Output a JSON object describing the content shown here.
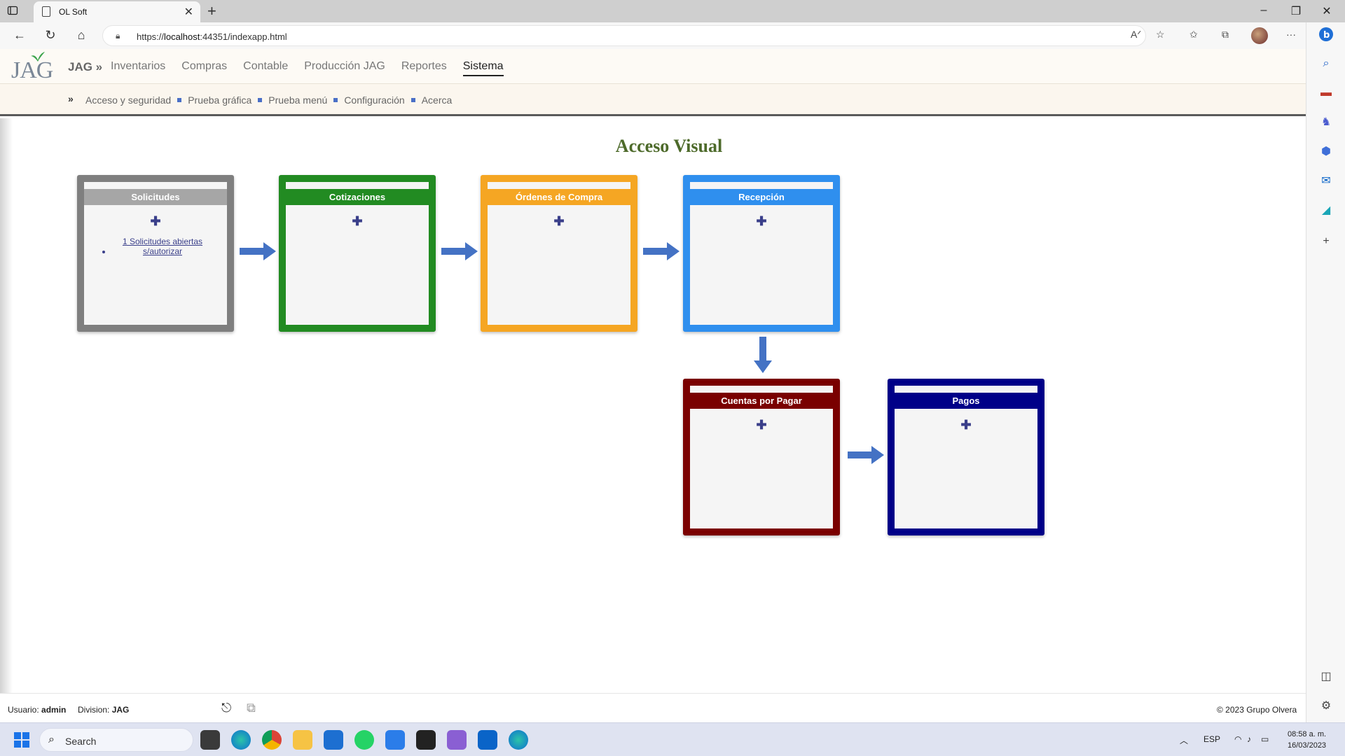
{
  "browser": {
    "tab_title": "OL Soft",
    "url_prefix": "https://",
    "url_host": "localhost",
    "url_rest": ":44351/indexapp.html"
  },
  "app": {
    "logo_text": "JAG",
    "brand": "JAG »",
    "nav": [
      {
        "label": "Inventarios"
      },
      {
        "label": "Compras"
      },
      {
        "label": "Contable"
      },
      {
        "label": "Producción JAG"
      },
      {
        "label": "Reportes"
      },
      {
        "label": "Sistema",
        "active": true
      }
    ],
    "subnav": [
      {
        "label": "Acceso y seguridad"
      },
      {
        "label": "Prueba gráfica"
      },
      {
        "label": "Prueba menú"
      },
      {
        "label": "Configuración"
      },
      {
        "label": "Acerca"
      }
    ],
    "page_title": "Acceso Visual",
    "boxes": [
      {
        "title": "Solicitudes",
        "color": "#7f7f7f",
        "head_color": "#a6a6a6",
        "plus": "✚",
        "items": [
          "1 Solicitudes abiertas s/autorizar"
        ]
      },
      {
        "title": "Cotizaciones",
        "color": "#228b22",
        "head_color": "#228b22",
        "plus": "✚",
        "items": []
      },
      {
        "title": "Órdenes de Compra",
        "color": "#f5a623",
        "head_color": "#f5a623",
        "plus": "✚",
        "items": []
      },
      {
        "title": "Recepción",
        "color": "#2f8fee",
        "head_color": "#2f8fee",
        "plus": "✚",
        "items": []
      },
      {
        "title": "Cuentas por Pagar",
        "color": "#7a0000",
        "head_color": "#7a0000",
        "plus": "✚",
        "items": []
      },
      {
        "title": "Pagos",
        "color": "#000088",
        "head_color": "#000088",
        "plus": "✚",
        "items": []
      }
    ],
    "arrow_color": "#4472c4",
    "footer": {
      "user_label": "Usuario:",
      "user_value": "admin",
      "division_label": "Division:",
      "division_value": "JAG",
      "copyright": "© 2023 Grupo Olvera"
    }
  },
  "taskbar": {
    "search_label": "Search",
    "lang": "ESP",
    "time": "08:58 a. m.",
    "date": "16/03/2023"
  }
}
